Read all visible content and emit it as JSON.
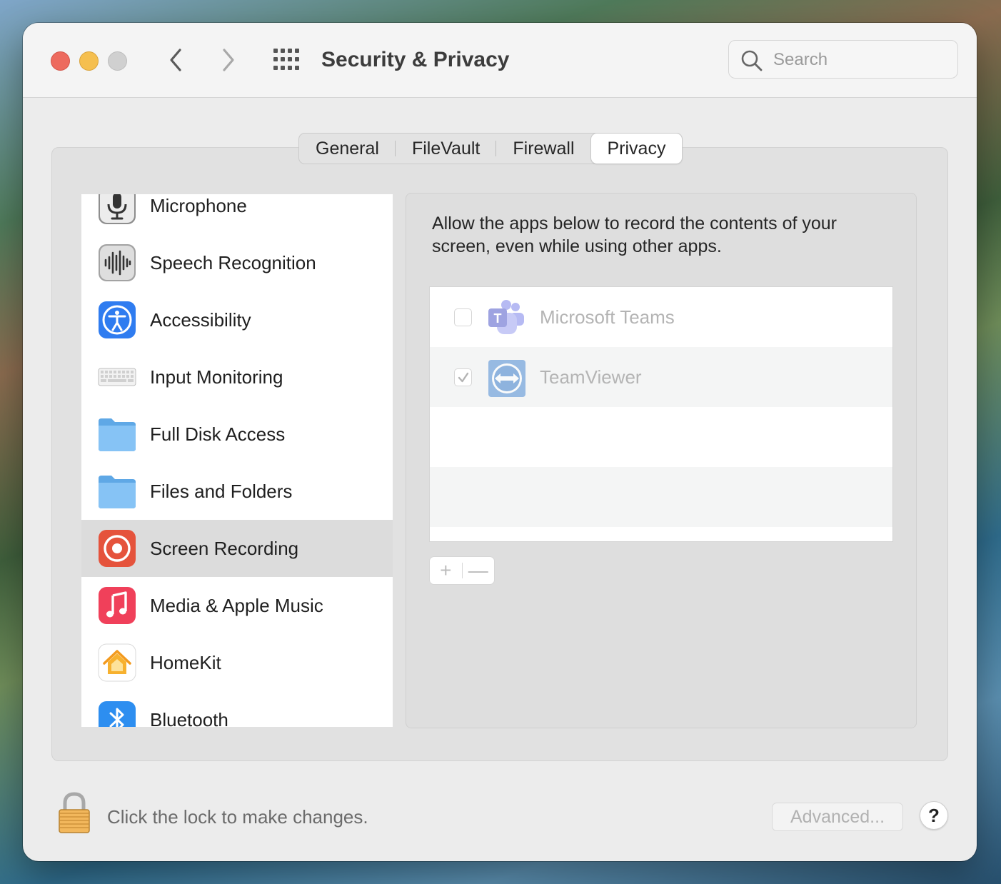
{
  "window": {
    "title": "Security & Privacy",
    "search_placeholder": "Search"
  },
  "tabs": [
    {
      "label": "General"
    },
    {
      "label": "FileVault"
    },
    {
      "label": "Firewall"
    },
    {
      "label": "Privacy",
      "active": true
    }
  ],
  "sidebar": {
    "items": [
      {
        "label": "Microphone",
        "icon": "microphone-icon"
      },
      {
        "label": "Speech Recognition",
        "icon": "waveform-icon"
      },
      {
        "label": "Accessibility",
        "icon": "accessibility-icon"
      },
      {
        "label": "Input Monitoring",
        "icon": "keyboard-icon"
      },
      {
        "label": "Full Disk Access",
        "icon": "folder-icon"
      },
      {
        "label": "Files and Folders",
        "icon": "folder-icon"
      },
      {
        "label": "Screen Recording",
        "icon": "screen-recording-icon",
        "selected": true
      },
      {
        "label": "Media & Apple Music",
        "icon": "music-note-icon"
      },
      {
        "label": "HomeKit",
        "icon": "home-icon"
      },
      {
        "label": "Bluetooth",
        "icon": "bluetooth-icon"
      }
    ]
  },
  "main": {
    "description": "Allow the apps below to record the contents of your screen, even while using other apps.",
    "apps": [
      {
        "name": "Microsoft Teams",
        "checked": false,
        "icon": "microsoft-teams-icon"
      },
      {
        "name": "TeamViewer",
        "checked": true,
        "icon": "teamviewer-icon"
      }
    ],
    "add_label": "+",
    "remove_label": "—"
  },
  "footer": {
    "lock_text": "Click the lock to make changes.",
    "advanced_label": "Advanced...",
    "help_label": "?"
  },
  "colors": {
    "close": "#ed6a5e",
    "minimize": "#f5bf4f",
    "zoom_disabled": "#d0d0d0",
    "selected_row": "#dcdcdc",
    "accent_red": "#e5533c"
  }
}
